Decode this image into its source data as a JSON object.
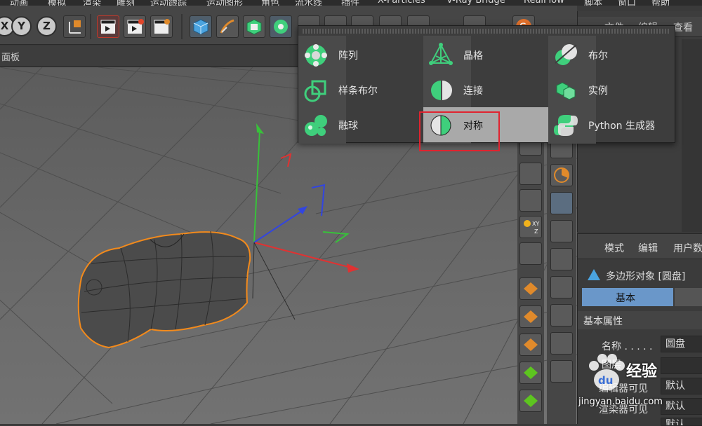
{
  "menubar": {
    "items": [
      "动画",
      "模拟",
      "渲染",
      "雕刻",
      "运动跟踪",
      "运动图形",
      "角色",
      "流水线",
      "插件",
      "X-Particles",
      "V-Ray Bridge",
      "RealFlow",
      "脚本",
      "窗口",
      "帮助"
    ]
  },
  "toolbar": {
    "axis_x": "X",
    "axis_y": "Y",
    "axis_z": "Z"
  },
  "viewport": {
    "panel_label": "面板"
  },
  "popup": {
    "items": [
      {
        "label": "阵列",
        "icon": "array-icon"
      },
      {
        "label": "晶格",
        "icon": "atom-array-icon"
      },
      {
        "label": "布尔",
        "icon": "boole-icon"
      },
      {
        "label": "样条布尔",
        "icon": "spline-boole-icon"
      },
      {
        "label": "连接",
        "icon": "connect-icon"
      },
      {
        "label": "实例",
        "icon": "instance-icon"
      },
      {
        "label": "融球",
        "icon": "metaball-icon"
      },
      {
        "label": "对称",
        "icon": "symmetry-icon",
        "highlighted": true
      },
      {
        "label": "Python 生成器",
        "icon": "python-generator-icon"
      }
    ]
  },
  "right_panel": {
    "tabs": [
      "文件",
      "编辑",
      "查看"
    ]
  },
  "attributes": {
    "tabs": [
      "模式",
      "编辑",
      "用户数"
    ],
    "object_title": "多边形对象 [圆盘]",
    "basic_tab": "基本",
    "section": "基本属性",
    "name_label": "名称 . . . . .",
    "name_value": "圆盘",
    "layer_label": "图层",
    "editor_vis_label": "编辑器可见",
    "editor_vis_value": "默认",
    "render_vis_label": "渲染器可见",
    "render_vis_value": "默认",
    "extra_value": "默认"
  },
  "watermark": {
    "brand": "经验",
    "url": "jingyan.baidu.com",
    "logo_text": "du"
  },
  "colors": {
    "accent_blue": "#6a97c9",
    "highlight_red": "#e0232f",
    "icon_green": "#3fcf7c",
    "selection_orange": "#f28a1c"
  }
}
